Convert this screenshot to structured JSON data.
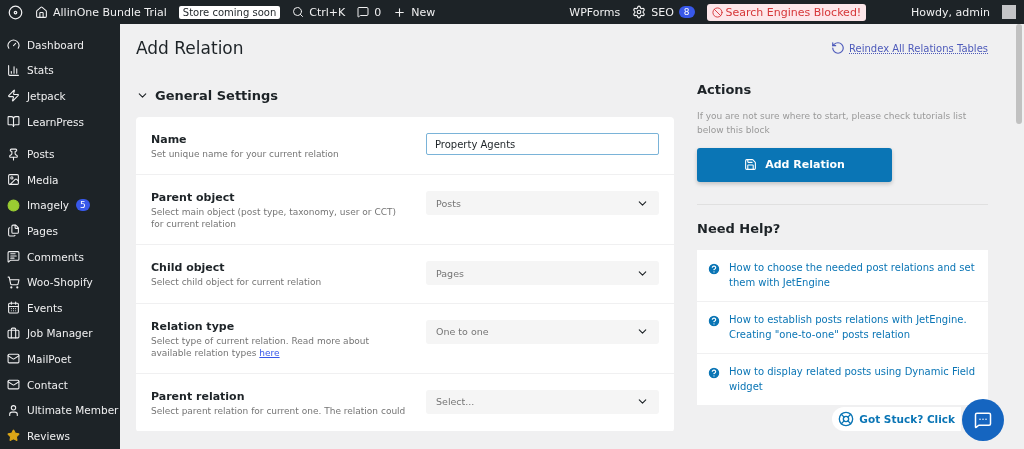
{
  "admin_bar": {
    "site_name": "AllinOne Bundle Trial",
    "store_badge": "Store coming soon",
    "search_shortcut": "Ctrl+K",
    "comments_count": "0",
    "new_label": "New",
    "wpforms": "WPForms",
    "seo_label": "SEO",
    "seo_count": "8",
    "alert": "Search Engines Blocked!",
    "greeting": "Howdy, admin"
  },
  "sidebar": {
    "groups": [
      {
        "items": [
          {
            "kind": "dashboard",
            "label": "Dashboard"
          },
          {
            "kind": "stats",
            "label": "Stats"
          },
          {
            "kind": "jetpack",
            "label": "Jetpack"
          },
          {
            "kind": "learnpress",
            "label": "LearnPress"
          }
        ]
      },
      {
        "items": [
          {
            "kind": "posts",
            "label": "Posts"
          },
          {
            "kind": "media",
            "label": "Media"
          },
          {
            "kind": "imagely",
            "label": "Imagely",
            "badge": "5"
          },
          {
            "kind": "pages",
            "label": "Pages"
          },
          {
            "kind": "comments",
            "label": "Comments"
          },
          {
            "kind": "shop",
            "label": "Woo-Shopify"
          },
          {
            "kind": "events",
            "label": "Events"
          },
          {
            "kind": "jobs",
            "label": "Job Manager"
          },
          {
            "kind": "mailpoet",
            "label": "MailPoet"
          },
          {
            "kind": "contact",
            "label": "Contact"
          },
          {
            "kind": "member",
            "label": "Ultimate Member"
          },
          {
            "kind": "reviews",
            "label": "Reviews"
          }
        ]
      }
    ]
  },
  "page": {
    "title": "Add Relation",
    "reindex_link": "Reindex All Relations Tables"
  },
  "general_settings": {
    "title": "General Settings",
    "expanded": true,
    "fields": [
      {
        "kind": "input",
        "label": "Name",
        "description": "Set unique name for your current relation",
        "value": "Property Agents",
        "focused": true
      },
      {
        "kind": "select",
        "label": "Parent object",
        "description": "Select main object (post type, taxonomy, user or CCT) for current relation",
        "value": "Posts"
      },
      {
        "kind": "select",
        "label": "Child object",
        "description": "Select child object for current relation",
        "value": "Pages"
      },
      {
        "kind": "select",
        "label": "Relation type",
        "description": "Select type of current relation. Read more about available relation types",
        "link": "here",
        "value": "One to one"
      },
      {
        "kind": "select",
        "label": "Parent relation",
        "description": "Select parent relation for current one. The relation could",
        "placeholder": "Select..."
      }
    ]
  },
  "actions": {
    "title": "Actions",
    "hint": "If you are not sure where to start, please check tutorials list below this block",
    "button": "Add Relation"
  },
  "help": {
    "title": "Need Help?",
    "items": [
      "How to choose the needed post relations and set them with JetEngine",
      "How to establish posts relations with JetEngine. Creating \"one-to-one\" posts relation",
      "How to display related posts using Dynamic Field widget"
    ]
  },
  "support": {
    "label": "Got Stuck? Click"
  }
}
